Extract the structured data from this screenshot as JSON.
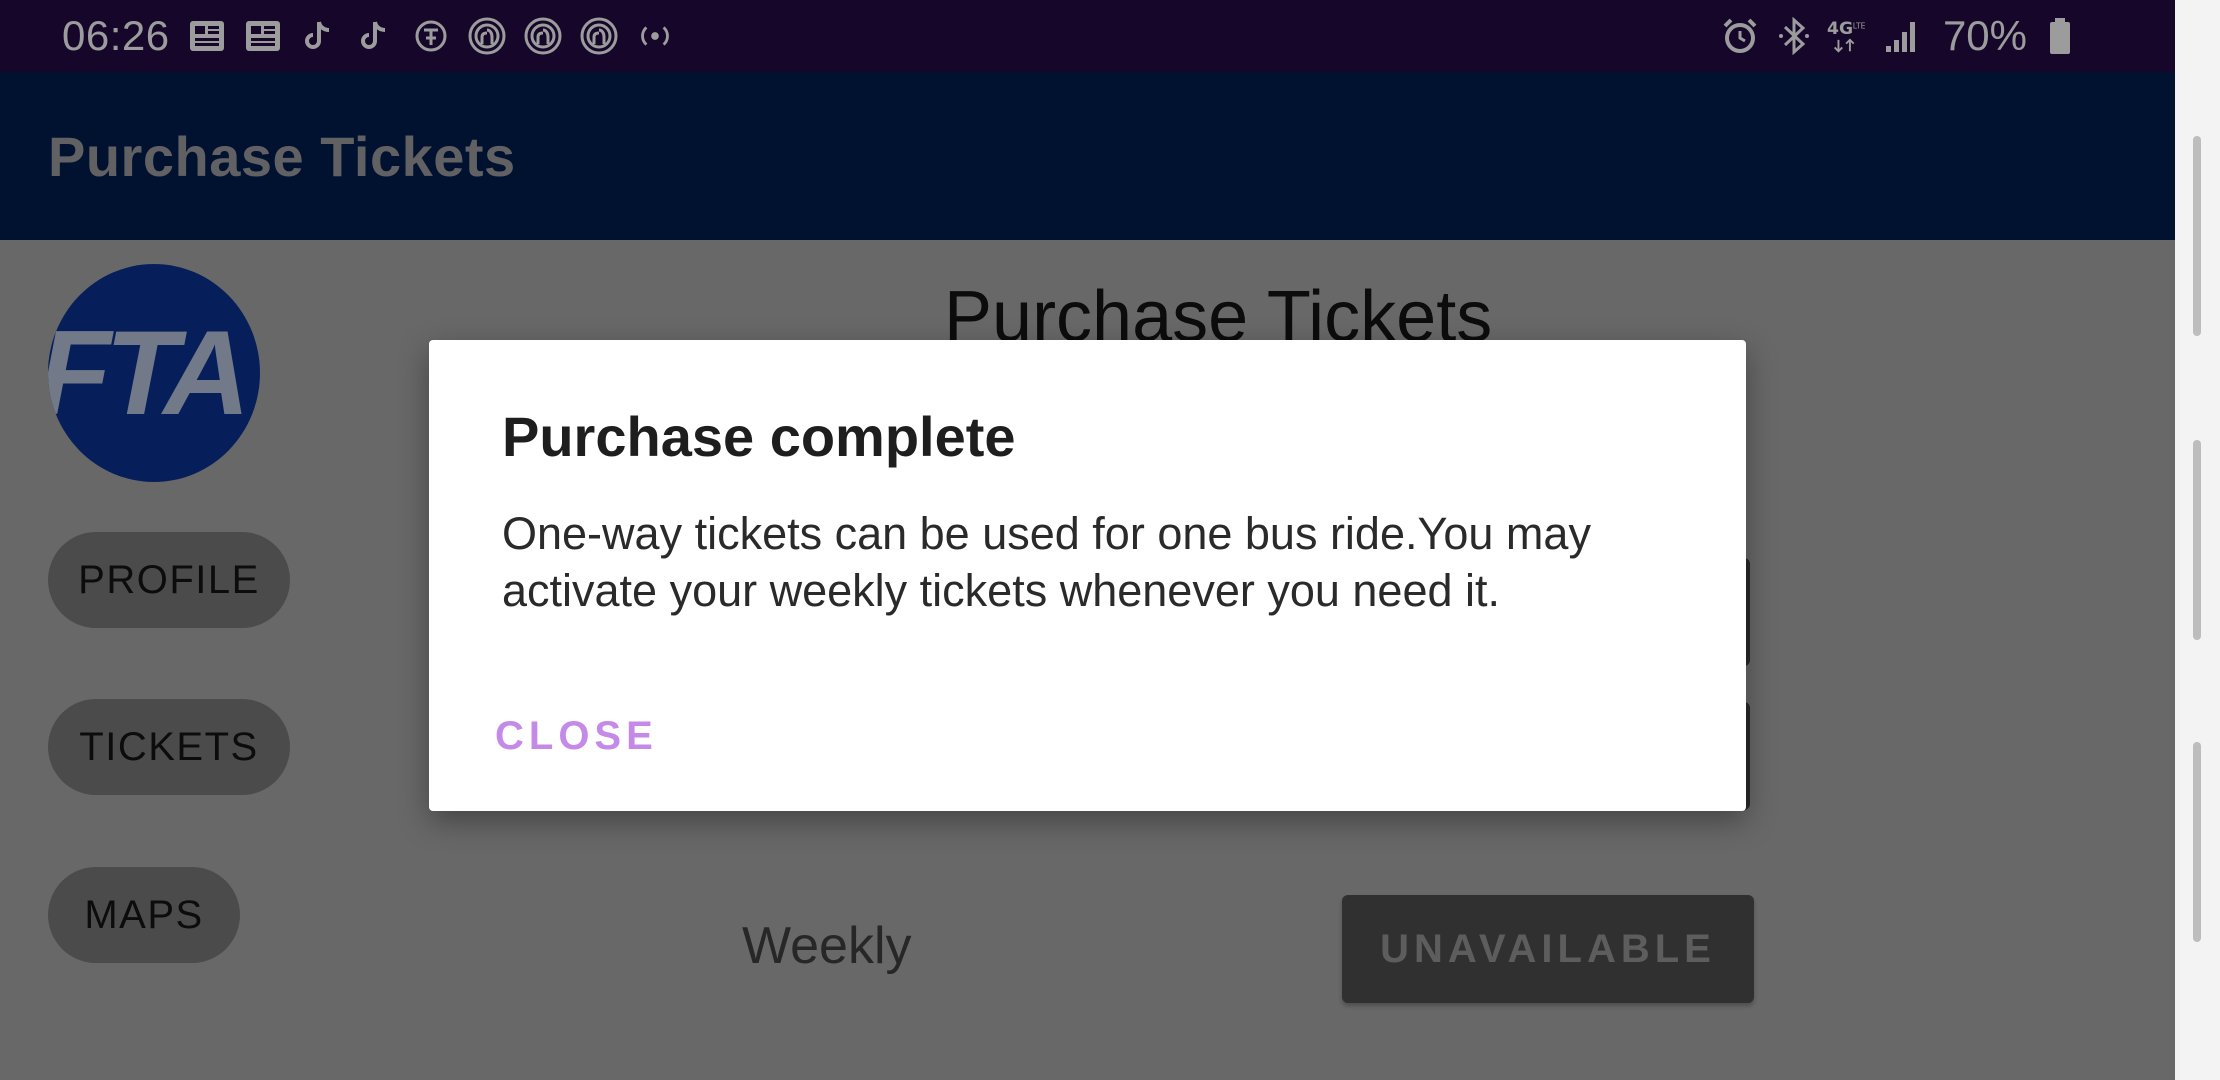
{
  "status_bar": {
    "time": "06:26",
    "notification_icons": [
      "news-icon",
      "news-icon",
      "tiktok-icon",
      "tiktok-icon",
      "nytimes-icon",
      "fingerprint-icon",
      "fingerprint-icon",
      "fingerprint-icon",
      "broadcast-icon"
    ],
    "system_icons": [
      "alarm-icon",
      "bluetooth-icon",
      "4g-lte-icon",
      "signal-icon"
    ],
    "battery_text": "70%"
  },
  "app_bar": {
    "title": "Purchase Tickets"
  },
  "sidebar": {
    "logo_text": "FTA",
    "buttons": [
      {
        "label": "PROFILE"
      },
      {
        "label": "TICKETS"
      },
      {
        "label": "MAPS"
      }
    ]
  },
  "main": {
    "title": "Purchase Tickets",
    "weekly_label": "Weekly",
    "unavailable_label": "UNAVAILABLE"
  },
  "dialog": {
    "title": "Purchase complete",
    "message": "One-way tickets can be used for one bus ride.You may activate your weekly tickets whenever you need it.",
    "close_label": "CLOSE"
  },
  "colors": {
    "status_bar": "#1f0a3f",
    "app_bar": "#021a48",
    "accent": "#c58ae8",
    "logo": "#0a2f86"
  }
}
